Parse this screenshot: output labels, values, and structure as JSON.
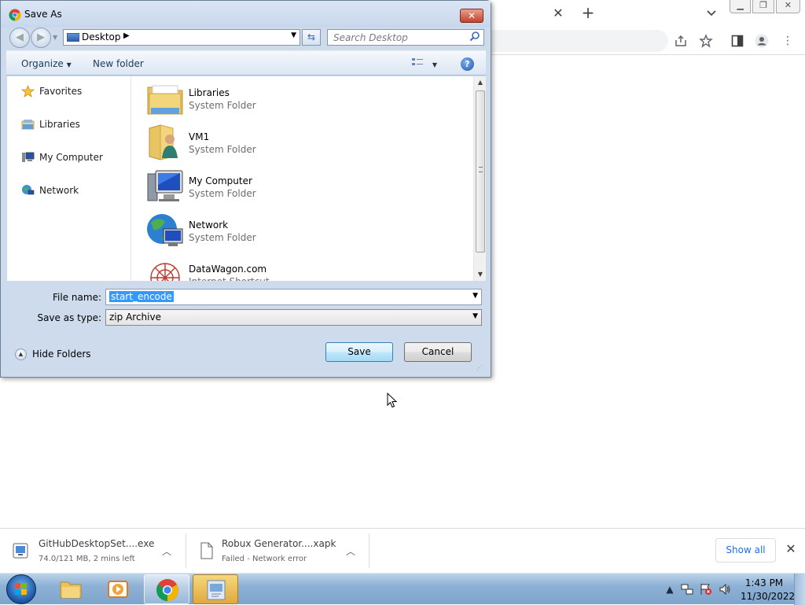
{
  "dialog": {
    "title": "Save As",
    "address": {
      "location": "Desktop"
    },
    "search_placeholder": "Search Desktop",
    "commands": {
      "organize": "Organize",
      "new_folder": "New folder"
    },
    "nav_pane": [
      {
        "label": "Favorites",
        "icon": "star-icon"
      },
      {
        "label": "Libraries",
        "icon": "libraries-icon"
      },
      {
        "label": "My Computer",
        "icon": "computer-icon"
      },
      {
        "label": "Network",
        "icon": "network-icon"
      }
    ],
    "files": [
      {
        "name": "Libraries",
        "type": "System Folder",
        "icon": "libraries-folder-icon"
      },
      {
        "name": "VM1",
        "type": "System Folder",
        "icon": "user-folder-icon"
      },
      {
        "name": "My Computer",
        "type": "System Folder",
        "icon": "computer-icon"
      },
      {
        "name": "Network",
        "type": "System Folder",
        "icon": "network-globe-icon"
      },
      {
        "name": "DataWagon.com",
        "type": "Internet Shortcut",
        "icon": "datawagon-logo-icon"
      }
    ],
    "file_name_label": "File name:",
    "file_name_value": "start_encode",
    "save_type_label": "Save as type:",
    "save_type_value": "zip Archive",
    "hide_folders": "Hide Folders",
    "save_button": "Save",
    "cancel_button": "Cancel"
  },
  "downloads": {
    "items": [
      {
        "name": "GitHubDesktopSet....exe",
        "status": "74.0/121 MB, 2 mins left",
        "icon": "installer-icon"
      },
      {
        "name": "Robux Generator....xapk",
        "status": "Failed - Network error",
        "icon": "file-icon"
      }
    ],
    "show_all": "Show all"
  },
  "taskbar": {
    "apps": [
      {
        "name": "explorer",
        "icon": "folder-icon"
      },
      {
        "name": "media-player",
        "icon": "media-player-icon"
      },
      {
        "name": "chrome",
        "icon": "chrome-icon"
      },
      {
        "name": "program",
        "icon": "program-icon"
      }
    ],
    "clock": {
      "time": "1:43 PM",
      "date": "11/30/2022"
    }
  },
  "colors": {
    "dialog_frame": "#cddbed",
    "selection": "#3399ff",
    "link_blue": "#1a73e8",
    "taskbar": "#8eb1d5"
  }
}
